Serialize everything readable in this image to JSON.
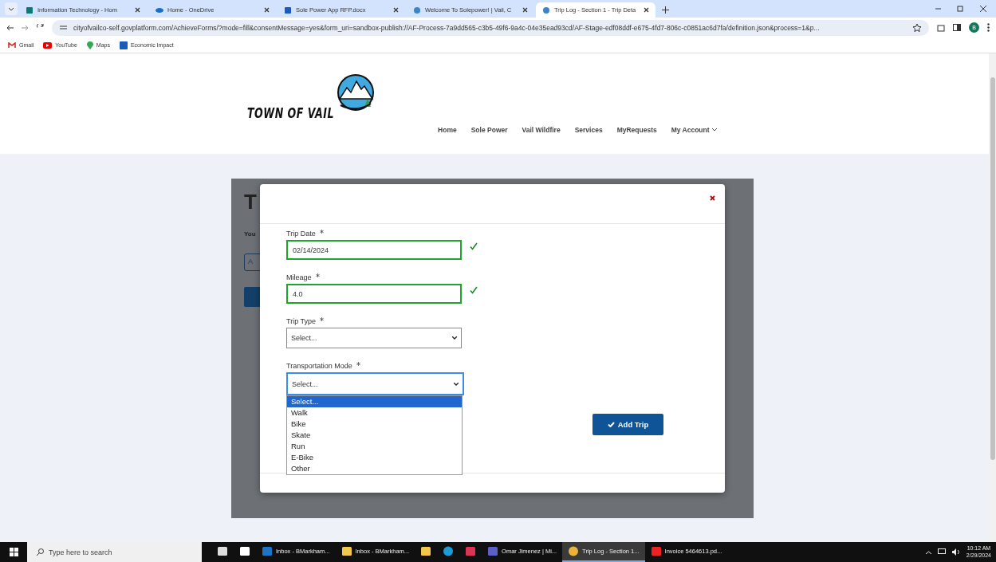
{
  "browser": {
    "tabs": [
      {
        "title": "Information Technology - Hom",
        "selected": false
      },
      {
        "title": "Home - OneDrive",
        "selected": false
      },
      {
        "title": "Sole Power App RFP.docx",
        "selected": false
      },
      {
        "title": "Welcome To Solepower! | Vail, C",
        "selected": false
      },
      {
        "title": "Trip Log - Section 1 - Trip Deta",
        "selected": true
      }
    ],
    "url": "cityofvailco-self.govplatform.com/AchieveForms/?mode=fill&consentMessage=yes&form_uri=sandbox-publish://AF-Process-7a9dd565-c3b5-49f6-9a4c-04e35ead93cd/AF-Stage-edf08ddf-e675-4fd7-806c-c0851ac6d7fa/definition.json&process=1&p...",
    "profile": "B",
    "bookmarks": [
      {
        "label": "Gmail"
      },
      {
        "label": "YouTube"
      },
      {
        "label": "Maps"
      },
      {
        "label": "Economic Impact"
      }
    ]
  },
  "site": {
    "logo": "TOWN OF VAIL",
    "nav": [
      {
        "label": "Home"
      },
      {
        "label": "Sole Power"
      },
      {
        "label": "Vail Wildfire"
      },
      {
        "label": "Services"
      },
      {
        "label": "MyRequests"
      },
      {
        "label": "My Account",
        "dropdown": true
      }
    ],
    "background": {
      "heading": "T",
      "intro": "You",
      "field": "A"
    }
  },
  "modal": {
    "fields": [
      {
        "label": "Trip Date",
        "required": true,
        "kind": "input",
        "value": "02/14/2024",
        "valid": true
      },
      {
        "label": "Mileage",
        "required": true,
        "kind": "input",
        "value": "4.0",
        "valid": true
      },
      {
        "label": "Trip Type",
        "required": true,
        "kind": "select",
        "value": "Select...",
        "focused": false
      },
      {
        "label": "Transportation Mode",
        "required": true,
        "kind": "select",
        "value": "Select...",
        "focused": true,
        "expanded": true,
        "options": [
          {
            "label": "Select...",
            "selected": true
          },
          {
            "label": "Walk",
            "selected": false
          },
          {
            "label": "Bike",
            "selected": false
          },
          {
            "label": "Skate",
            "selected": false
          },
          {
            "label": "Run",
            "selected": false
          },
          {
            "label": "E-Bike",
            "selected": false
          },
          {
            "label": "Other",
            "selected": false
          }
        ]
      }
    ],
    "submit": "Add Trip"
  },
  "taskbar": {
    "search_placeholder": "Type here to search",
    "apps": [
      {
        "kind": "pinned"
      },
      {
        "kind": "pinned"
      },
      {
        "kind": "window",
        "label": "Inbox - BMarkham...",
        "active": false
      },
      {
        "kind": "window",
        "label": "Inbox - BMarkham...",
        "active": false
      },
      {
        "kind": "pinned"
      },
      {
        "kind": "pinned"
      },
      {
        "kind": "pinned"
      },
      {
        "kind": "window",
        "label": "Omar Jimenez | Mi...",
        "active": false
      },
      {
        "kind": "window",
        "label": "Trip Log - Section 1...",
        "active": true
      },
      {
        "kind": "window",
        "label": "Invoice 5464613.pd...",
        "active": false
      }
    ],
    "time": "10:12 AM",
    "date": "2/29/2024"
  }
}
